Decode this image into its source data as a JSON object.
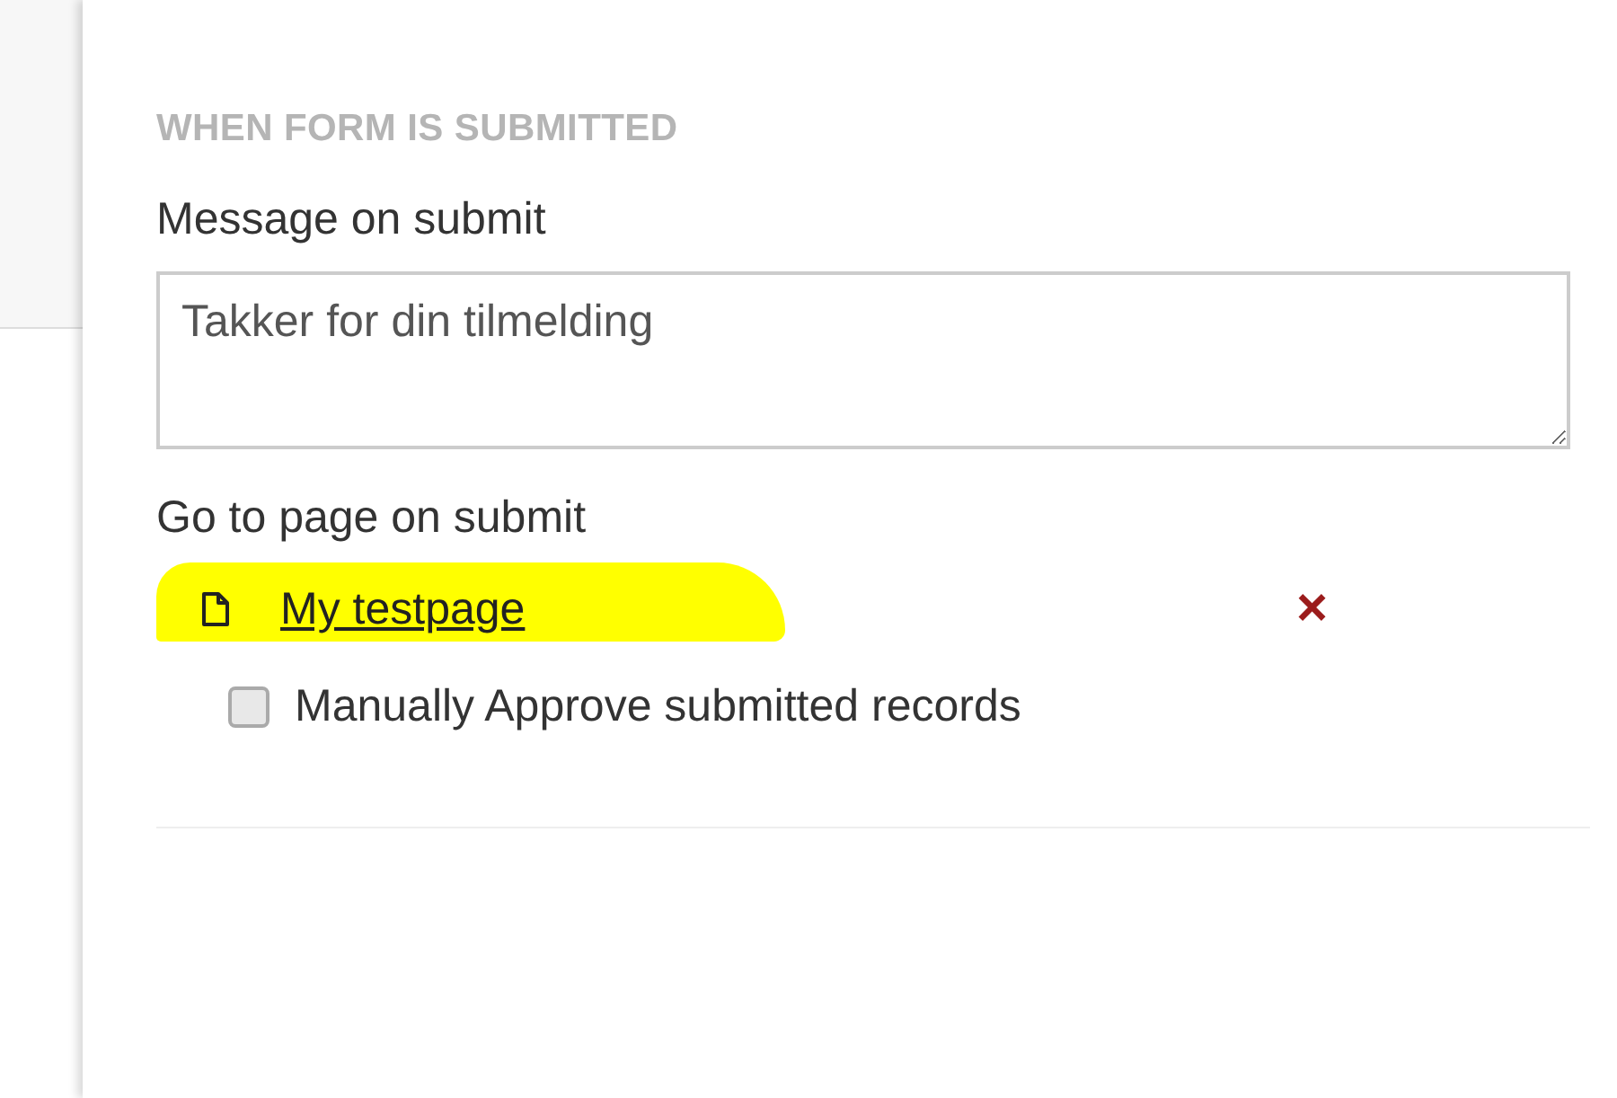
{
  "section_title": "WHEN FORM IS SUBMITTED",
  "message": {
    "label": "Message on submit",
    "value": "Takker for din tilmelding"
  },
  "goto": {
    "label": "Go to page on submit",
    "page": "My testpage",
    "remove": "×",
    "highlighted": true
  },
  "approve": {
    "label": "Manually Approve submitted records",
    "checked": false
  }
}
